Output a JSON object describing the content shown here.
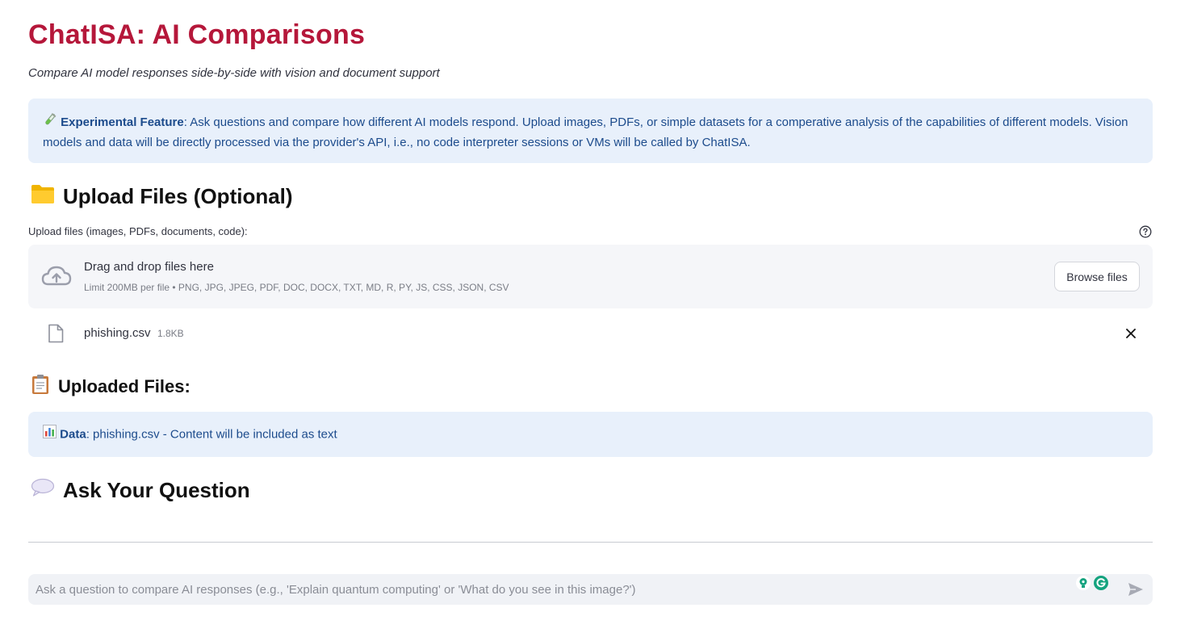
{
  "header": {
    "title": "ChatISA: AI Comparisons",
    "subtitle": "Compare AI model responses side-by-side with vision and document support"
  },
  "info_banner": {
    "icon": "test-tube-icon",
    "label": "Experimental Feature",
    "text": ": Ask questions and compare how different AI models respond. Upload images, PDFs, or simple datasets for a comperative analysis of the capabilities of different models. Vision models and data will be directly processed via the provider's API, i.e., no code interpreter sessions or VMs will be called by ChatISA."
  },
  "upload_section": {
    "icon": "folder-icon",
    "heading": "Upload Files (Optional)",
    "label": "Upload files (images, PDFs, documents, code):",
    "dropzone_title": "Drag and drop files here",
    "dropzone_limit": "Limit 200MB per file • PNG, JPG, JPEG, PDF, DOC, DOCX, TXT, MD, R, PY, JS, CSS, JSON, CSV",
    "browse_label": "Browse files",
    "files": [
      {
        "name": "phishing.csv",
        "size": "1.8KB"
      }
    ]
  },
  "uploaded_section": {
    "icon": "clipboard-icon",
    "heading": "Uploaded Files:",
    "items": [
      {
        "icon": "bar-chart-icon",
        "label": "Data",
        "text": ": phishing.csv - Content will be included as text"
      }
    ]
  },
  "question_section": {
    "icon": "speech-bubble-icon",
    "heading": "Ask Your Question"
  },
  "chat": {
    "placeholder": "Ask a question to compare AI responses (e.g., 'Explain quantum computing' or 'What do you see in this image?')",
    "value": ""
  },
  "colors": {
    "title": "#b5173a",
    "info_bg": "#e8f0fb",
    "info_text": "#1c4b8c",
    "dropzone_bg": "#f5f6f9",
    "chat_bg": "#f0f2f6"
  }
}
